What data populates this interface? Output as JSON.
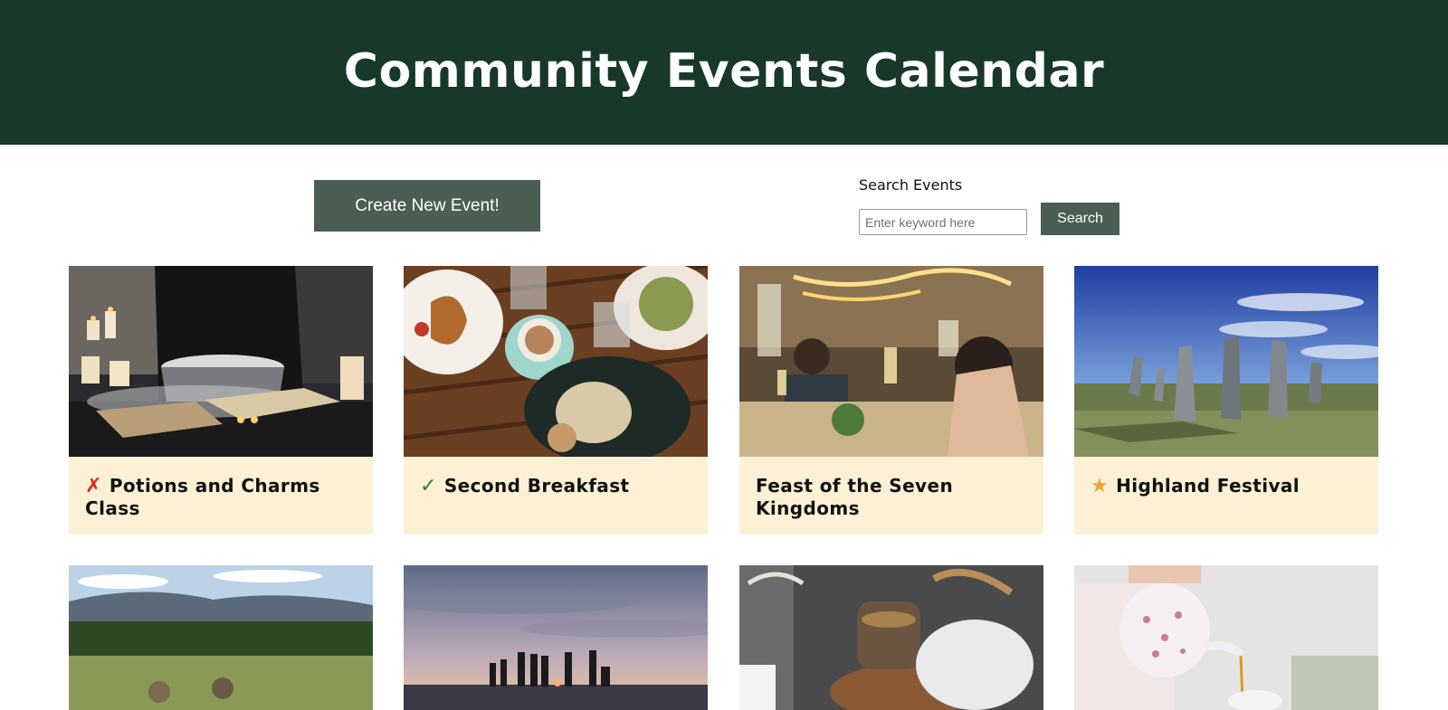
{
  "header": {
    "title": "Community Events Calendar"
  },
  "toolbar": {
    "create_label": "Create New Event!",
    "search_label": "Search Events",
    "search_placeholder": "Enter keyword here",
    "search_value": "",
    "search_button": "Search"
  },
  "events": [
    {
      "title": "Potions and Charms Class",
      "status": "cancelled",
      "status_glyph": "✗",
      "image": "potion-cauldron-photo"
    },
    {
      "title": "Second Breakfast",
      "status": "confirmed",
      "status_glyph": "✓",
      "image": "breakfast-table-photo"
    },
    {
      "title": "Feast of the Seven Kingdoms",
      "status": "",
      "status_glyph": "",
      "image": "banquet-hall-photo"
    },
    {
      "title": "Highland Festival",
      "status": "featured",
      "status_glyph": "★",
      "image": "standing-stones-photo"
    },
    {
      "title": "",
      "image": "hiking-meadow-photo"
    },
    {
      "title": "",
      "image": "beach-sunset-bonfire-photo"
    },
    {
      "title": "",
      "image": "tea-set-photo"
    },
    {
      "title": "",
      "image": "teapot-pouring-photo"
    }
  ],
  "colors": {
    "header_bg": "#183829",
    "button_bg": "#4a5e52",
    "caption_bg": "#fcf1d4",
    "cancel": "#e2231a",
    "confirm": "#2e7d32",
    "star": "#f0a23b"
  }
}
